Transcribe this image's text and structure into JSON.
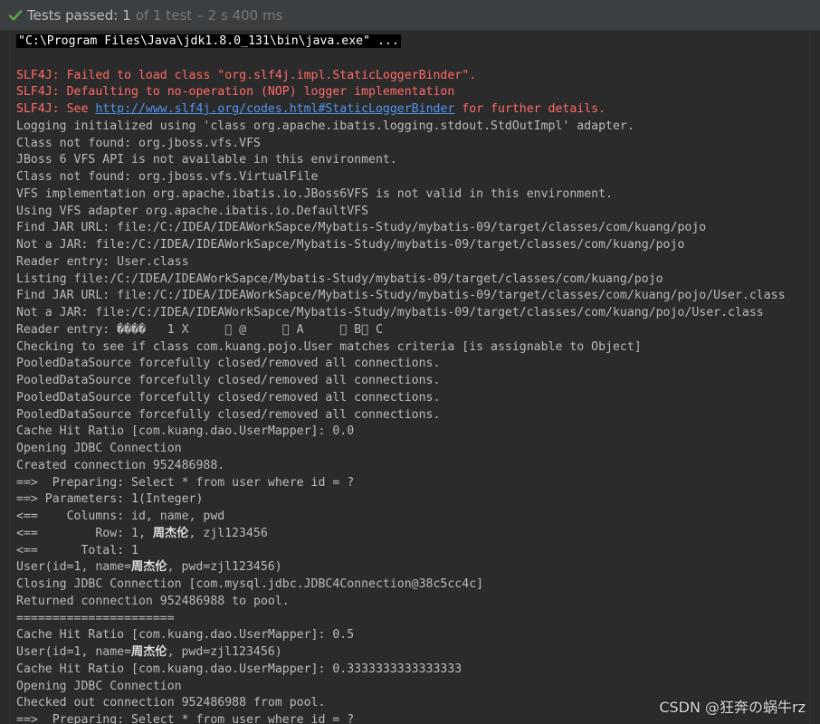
{
  "status": {
    "label": "Tests passed:",
    "count": "1",
    "total": "of 1 test",
    "separator": "–",
    "time": "2 s 400 ms",
    "color": "#5fa049"
  },
  "console": {
    "lines": [
      {
        "type": "cmd",
        "text": "\"C:\\Program Files\\Java\\jdk1.8.0_131\\bin\\java.exe\" ..."
      },
      {
        "type": "plain",
        "text": ""
      },
      {
        "type": "err",
        "text": "SLF4J: Failed to load class \"org.slf4j.impl.StaticLoggerBinder\"."
      },
      {
        "type": "err",
        "text": "SLF4J: Defaulting to no-operation (NOP) logger implementation"
      },
      {
        "type": "errlink",
        "prefix": "SLF4J: See ",
        "link": "http://www.slf4j.org/codes.html#StaticLoggerBinder",
        "suffix": " for further details."
      },
      {
        "type": "plain",
        "text": "Logging initialized using 'class org.apache.ibatis.logging.stdout.StdOutImpl' adapter."
      },
      {
        "type": "plain",
        "text": "Class not found: org.jboss.vfs.VFS"
      },
      {
        "type": "plain",
        "text": "JBoss 6 VFS API is not available in this environment."
      },
      {
        "type": "plain",
        "text": "Class not found: org.jboss.vfs.VirtualFile"
      },
      {
        "type": "plain",
        "text": "VFS implementation org.apache.ibatis.io.JBoss6VFS is not valid in this environment."
      },
      {
        "type": "plain",
        "text": "Using VFS adapter org.apache.ibatis.io.DefaultVFS"
      },
      {
        "type": "plain",
        "text": "Find JAR URL: file:/C:/IDEA/IDEAWorkSapce/Mybatis-Study/mybatis-09/target/classes/com/kuang/pojo"
      },
      {
        "type": "plain",
        "text": "Not a JAR: file:/C:/IDEA/IDEAWorkSapce/Mybatis-Study/mybatis-09/target/classes/com/kuang/pojo"
      },
      {
        "type": "plain",
        "text": "Reader entry: User.class"
      },
      {
        "type": "plain",
        "text": "Listing file:/C:/IDEA/IDEAWorkSapce/Mybatis-Study/mybatis-09/target/classes/com/kuang/pojo"
      },
      {
        "type": "plain",
        "text": "Find JAR URL: file:/C:/IDEA/IDEAWorkSapce/Mybatis-Study/mybatis-09/target/classes/com/kuang/pojo/User.class"
      },
      {
        "type": "plain",
        "text": "Not a JAR: file:/C:/IDEA/IDEAWorkSapce/Mybatis-Study/mybatis-09/target/classes/com/kuang/pojo/User.class"
      },
      {
        "type": "plain",
        "text": "Reader entry: ����   1 X     \u0000 @     \u0000 A     \u0000 B\u0000 C"
      },
      {
        "type": "plain",
        "text": "Checking to see if class com.kuang.pojo.User matches criteria [is assignable to Object]"
      },
      {
        "type": "plain",
        "text": "PooledDataSource forcefully closed/removed all connections."
      },
      {
        "type": "plain",
        "text": "PooledDataSource forcefully closed/removed all connections."
      },
      {
        "type": "plain",
        "text": "PooledDataSource forcefully closed/removed all connections."
      },
      {
        "type": "plain",
        "text": "PooledDataSource forcefully closed/removed all connections."
      },
      {
        "type": "plain",
        "text": "Cache Hit Ratio [com.kuang.dao.UserMapper]: 0.0"
      },
      {
        "type": "plain",
        "text": "Opening JDBC Connection"
      },
      {
        "type": "plain",
        "text": "Created connection 952486988."
      },
      {
        "type": "plain",
        "text": "==>  Preparing: Select * from user where id = ?"
      },
      {
        "type": "plain",
        "text": "==> Parameters: 1(Integer)"
      },
      {
        "type": "plain",
        "text": "<==    Columns: id, name, pwd"
      },
      {
        "type": "cjk",
        "prefix": "<==        Row: 1, ",
        "cjk": "周杰伦",
        "suffix": ", zjl123456"
      },
      {
        "type": "plain",
        "text": "<==      Total: 1"
      },
      {
        "type": "cjk",
        "prefix": "User(id=1, name=",
        "cjk": "周杰伦",
        "suffix": ", pwd=zjl123456)"
      },
      {
        "type": "plain",
        "text": "Closing JDBC Connection [com.mysql.jdbc.JDBC4Connection@38c5cc4c]"
      },
      {
        "type": "plain",
        "text": "Returned connection 952486988 to pool."
      },
      {
        "type": "plain",
        "text": "======================"
      },
      {
        "type": "plain",
        "text": "Cache Hit Ratio [com.kuang.dao.UserMapper]: 0.5"
      },
      {
        "type": "cjk",
        "prefix": "User(id=1, name=",
        "cjk": "周杰伦",
        "suffix": ", pwd=zjl123456)"
      },
      {
        "type": "plain",
        "text": "Cache Hit Ratio [com.kuang.dao.UserMapper]: 0.3333333333333333"
      },
      {
        "type": "plain",
        "text": "Opening JDBC Connection"
      },
      {
        "type": "plain",
        "text": "Checked out connection 952486988 from pool."
      },
      {
        "type": "plain",
        "text": "==>  Preparing: Select * from user where id = ?"
      }
    ]
  },
  "watermark": "CSDN @狂奔の蜗牛rz",
  "colors": {
    "background": "#2b2b2b",
    "text": "#bbbbbb",
    "error": "#ff6b68",
    "link": "#5394ec"
  }
}
